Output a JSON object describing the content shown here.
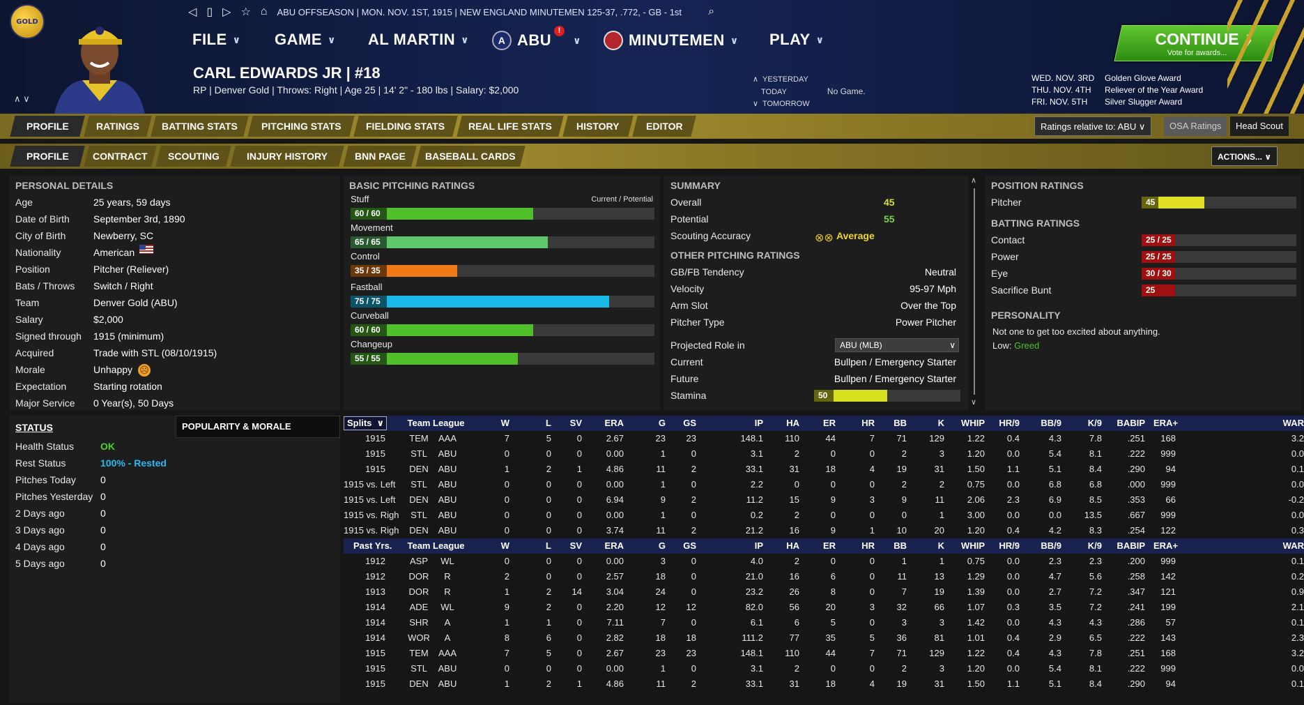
{
  "topbar": {
    "status": "ABU OFFSEASON  |  MON. NOV. 1ST, 1915  |  NEW ENGLAND MINUTEMEN  125-37, .772, - GB - 1st"
  },
  "menus": {
    "file": "FILE",
    "game": "GAME",
    "league": "AL MARTIN",
    "abu": "ABU",
    "team": "MINUTEMEN",
    "play": "PLAY"
  },
  "player": {
    "name": "CARL EDWARDS JR  |  #18",
    "info": "RP | Denver Gold  |  Throws: Right  |  Age 25  |  14' 2\" - 180 lbs  |  Salary: $2,000"
  },
  "schedule": {
    "yesterday": "YESTERDAY",
    "today": "TODAY",
    "today_value": "No Game.",
    "tomorrow": "TOMORROW"
  },
  "awards": [
    {
      "date": "WED. NOV. 3RD",
      "award": "Golden Glove Award"
    },
    {
      "date": "THU. NOV. 4TH",
      "award": "Reliever of the Year Award"
    },
    {
      "date": "FRI. NOV. 5TH",
      "award": "Silver Slugger Award"
    }
  ],
  "continue": {
    "label": "CONTINUE",
    "sub": "Vote for awards...",
    "arrow": "〉"
  },
  "tabs_main": [
    "PROFILE",
    "RATINGS",
    "BATTING STATS",
    "PITCHING STATS",
    "FIELDING STATS",
    "REAL LIFE STATS",
    "HISTORY",
    "EDITOR"
  ],
  "tabs_sub": [
    "PROFILE",
    "CONTRACT",
    "SCOUTING",
    "INJURY HISTORY",
    "BNN PAGE",
    "BASEBALL CARDS"
  ],
  "tab_right": {
    "relative": "Ratings relative to: ABU",
    "osa": "OSA Ratings",
    "scout": "Head Scout",
    "actions": "ACTIONS..."
  },
  "personal": {
    "title": "PERSONAL DETAILS",
    "rows": [
      {
        "label": "Age",
        "value": "25 years, 59 days"
      },
      {
        "label": "Date of Birth",
        "value": "September 3rd, 1890"
      },
      {
        "label": "City of Birth",
        "value": "Newberry, SC"
      },
      {
        "label": "Nationality",
        "value": "American"
      },
      {
        "label": "Position",
        "value": "Pitcher (Reliever)"
      },
      {
        "label": "Bats / Throws",
        "value": "Switch / Right"
      },
      {
        "label": "Team",
        "value": "Denver Gold (ABU)"
      },
      {
        "label": "Salary",
        "value": "$2,000"
      },
      {
        "label": "Signed through",
        "value": "1915 (minimum)"
      },
      {
        "label": "Acquired",
        "value": "Trade with STL (08/10/1915)"
      },
      {
        "label": "Morale",
        "value": "Unhappy"
      },
      {
        "label": "Expectation",
        "value": "Starting rotation"
      },
      {
        "label": "Major Service",
        "value": "0 Year(s), 50 Days"
      }
    ]
  },
  "status": {
    "title": "STATUS",
    "popularity_tab": "POPULARITY & MORALE",
    "rows": [
      {
        "label": "Health Status",
        "value": "OK"
      },
      {
        "label": "Rest Status",
        "value": "100% - Rested"
      },
      {
        "label": "Pitches Today",
        "value": "0"
      },
      {
        "label": "Pitches Yesterday",
        "value": "0"
      },
      {
        "label": "2 Days ago",
        "value": "0"
      },
      {
        "label": "3 Days ago",
        "value": "0"
      },
      {
        "label": "4 Days ago",
        "value": "0"
      },
      {
        "label": "5 Days ago",
        "value": "0"
      }
    ]
  },
  "pitching": {
    "title": "BASIC PITCHING RATINGS",
    "legend": "Current / Potential",
    "ratings": [
      {
        "name": "Stuff",
        "label": "60 / 60",
        "pct": 0.6,
        "color": "#4fc02a"
      },
      {
        "name": "Movement",
        "label": "65 / 65",
        "pct": 0.65,
        "color": "#5ec86a"
      },
      {
        "name": "Control",
        "label": "35 / 35",
        "pct": 0.35,
        "color": "#f07a16"
      },
      {
        "name": "Fastball",
        "label": "75 / 75",
        "pct": 0.85,
        "color": "#1ab8e6"
      },
      {
        "name": "Curveball",
        "label": "60 / 60",
        "pct": 0.6,
        "color": "#4fc02a"
      },
      {
        "name": "Changeup",
        "label": "55 / 55",
        "pct": 0.55,
        "color": "#4fc02a"
      }
    ]
  },
  "summary": {
    "title": "SUMMARY",
    "overall_label": "Overall",
    "overall": "45",
    "potential_label": "Potential",
    "potential": "55",
    "scouting_label": "Scouting Accuracy",
    "scouting": "Average",
    "other_title": "OTHER PITCHING RATINGS",
    "rows": [
      {
        "label": "GB/FB Tendency",
        "value": "Neutral"
      },
      {
        "label": "Velocity",
        "value": "95-97 Mph"
      },
      {
        "label": "Arm Slot",
        "value": "Over the Top"
      },
      {
        "label": "Pitcher Type",
        "value": "Power Pitcher"
      }
    ],
    "proj_label": "Projected Role in",
    "proj_select": "ABU (MLB)",
    "current_label": "Current",
    "current": "Bullpen / Emergency Starter",
    "future_label": "Future",
    "future": "Bullpen / Emergency Starter",
    "stamina_label": "Stamina",
    "stamina": "50",
    "stamina_pct": 0.5
  },
  "position": {
    "title": "POSITION RATINGS",
    "pitcher_label": "Pitcher",
    "pitcher": "45",
    "pitcher_pct": 0.45,
    "batting_title": "BATTING RATINGS",
    "batting": [
      {
        "name": "Contact",
        "label": "25 / 25",
        "pct": 0.12
      },
      {
        "name": "Power",
        "label": "25 / 25",
        "pct": 0.12
      },
      {
        "name": "Eye",
        "label": "30 / 30",
        "pct": 0.2
      },
      {
        "name": "Sacrifice Bunt",
        "label": "25",
        "pct": 0.12
      }
    ],
    "personality_title": "PERSONALITY",
    "personality_text": "Not one to get too excited about anything.",
    "low_label": "Low:",
    "low_value": "Greed"
  },
  "stats": {
    "split_label": "Splits",
    "headers": [
      "Team",
      "League",
      "W",
      "L",
      "SV",
      "ERA",
      "G",
      "GS",
      "IP",
      "HA",
      "ER",
      "HR",
      "BB",
      "K",
      "WHIP",
      "HR/9",
      "BB/9",
      "K/9",
      "BABIP",
      "ERA+",
      "WAR"
    ],
    "splits": [
      [
        "1915",
        "TEM",
        "AAA",
        "7",
        "5",
        "0",
        "2.67",
        "23",
        "23",
        "148.1",
        "110",
        "44",
        "7",
        "71",
        "129",
        "1.22",
        "0.4",
        "4.3",
        "7.8",
        ".251",
        "168",
        "3.2"
      ],
      [
        "1915",
        "STL",
        "ABU",
        "0",
        "0",
        "0",
        "0.00",
        "1",
        "0",
        "3.1",
        "2",
        "0",
        "0",
        "2",
        "3",
        "1.20",
        "0.0",
        "5.4",
        "8.1",
        ".222",
        "999",
        "0.0"
      ],
      [
        "1915",
        "DEN",
        "ABU",
        "1",
        "2",
        "1",
        "4.86",
        "11",
        "2",
        "33.1",
        "31",
        "18",
        "4",
        "19",
        "31",
        "1.50",
        "1.1",
        "5.1",
        "8.4",
        ".290",
        "94",
        "0.1"
      ],
      [
        "1915 vs. Left",
        "STL",
        "ABU",
        "0",
        "0",
        "0",
        "0.00",
        "1",
        "0",
        "2.2",
        "0",
        "0",
        "0",
        "2",
        "2",
        "0.75",
        "0.0",
        "6.8",
        "6.8",
        ".000",
        "999",
        "0.0"
      ],
      [
        "1915 vs. Left",
        "DEN",
        "ABU",
        "0",
        "0",
        "0",
        "6.94",
        "9",
        "2",
        "11.2",
        "15",
        "9",
        "3",
        "9",
        "11",
        "2.06",
        "2.3",
        "6.9",
        "8.5",
        ".353",
        "66",
        "-0.2"
      ],
      [
        "1915 vs. Righ",
        "STL",
        "ABU",
        "0",
        "0",
        "0",
        "0.00",
        "1",
        "0",
        "0.2",
        "2",
        "0",
        "0",
        "0",
        "1",
        "3.00",
        "0.0",
        "0.0",
        "13.5",
        ".667",
        "999",
        "0.0"
      ],
      [
        "1915 vs. Righ",
        "DEN",
        "ABU",
        "0",
        "0",
        "0",
        "3.74",
        "11",
        "2",
        "21.2",
        "16",
        "9",
        "1",
        "10",
        "20",
        "1.20",
        "0.4",
        "4.2",
        "8.3",
        ".254",
        "122",
        "0.3"
      ]
    ],
    "past_label": "Past Yrs.",
    "past": [
      [
        "1912",
        "ASP",
        "WL",
        "0",
        "0",
        "0",
        "0.00",
        "3",
        "0",
        "4.0",
        "2",
        "0",
        "0",
        "1",
        "1",
        "0.75",
        "0.0",
        "2.3",
        "2.3",
        ".200",
        "999",
        "0.1"
      ],
      [
        "1912",
        "DOR",
        "R",
        "2",
        "0",
        "0",
        "2.57",
        "18",
        "0",
        "21.0",
        "16",
        "6",
        "0",
        "11",
        "13",
        "1.29",
        "0.0",
        "4.7",
        "5.6",
        ".258",
        "142",
        "0.2"
      ],
      [
        "1913",
        "DOR",
        "R",
        "1",
        "2",
        "14",
        "3.04",
        "24",
        "0",
        "23.2",
        "26",
        "8",
        "0",
        "7",
        "19",
        "1.39",
        "0.0",
        "2.7",
        "7.2",
        ".347",
        "121",
        "0.9"
      ],
      [
        "1914",
        "ADE",
        "WL",
        "9",
        "2",
        "0",
        "2.20",
        "12",
        "12",
        "82.0",
        "56",
        "20",
        "3",
        "32",
        "66",
        "1.07",
        "0.3",
        "3.5",
        "7.2",
        ".241",
        "199",
        "2.1"
      ],
      [
        "1914",
        "SHR",
        "A",
        "1",
        "1",
        "0",
        "7.11",
        "7",
        "0",
        "6.1",
        "6",
        "5",
        "0",
        "3",
        "3",
        "1.42",
        "0.0",
        "4.3",
        "4.3",
        ".286",
        "57",
        "0.1"
      ],
      [
        "1914",
        "WOR",
        "A",
        "8",
        "6",
        "0",
        "2.82",
        "18",
        "18",
        "111.2",
        "77",
        "35",
        "5",
        "36",
        "81",
        "1.01",
        "0.4",
        "2.9",
        "6.5",
        ".222",
        "143",
        "2.3"
      ],
      [
        "1915",
        "TEM",
        "AAA",
        "7",
        "5",
        "0",
        "2.67",
        "23",
        "23",
        "148.1",
        "110",
        "44",
        "7",
        "71",
        "129",
        "1.22",
        "0.4",
        "4.3",
        "7.8",
        ".251",
        "168",
        "3.2"
      ],
      [
        "1915",
        "STL",
        "ABU",
        "0",
        "0",
        "0",
        "0.00",
        "1",
        "0",
        "3.1",
        "2",
        "0",
        "0",
        "2",
        "3",
        "1.20",
        "0.0",
        "5.4",
        "8.1",
        ".222",
        "999",
        "0.0"
      ],
      [
        "1915",
        "DEN",
        "ABU",
        "1",
        "2",
        "1",
        "4.86",
        "11",
        "2",
        "33.1",
        "31",
        "18",
        "4",
        "19",
        "31",
        "1.50",
        "1.1",
        "5.1",
        "8.4",
        ".290",
        "94",
        "0.1"
      ]
    ]
  }
}
